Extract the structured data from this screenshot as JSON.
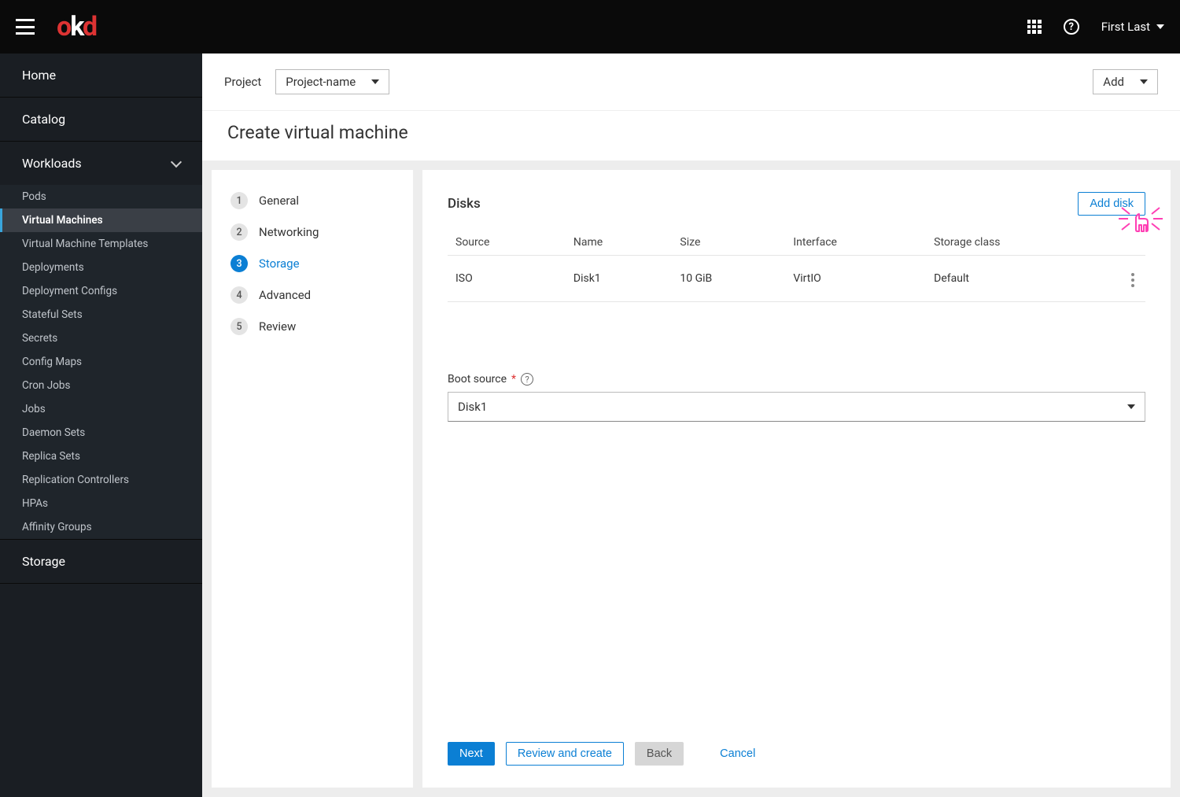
{
  "topbar": {
    "logo": "okd",
    "user_name": "First Last"
  },
  "sidebar": {
    "home": "Home",
    "catalog": "Catalog",
    "workloads": "Workloads",
    "storage": "Storage",
    "items": [
      {
        "label": "Pods"
      },
      {
        "label": "Virtual Machines"
      },
      {
        "label": "Virtual Machine Templates"
      },
      {
        "label": "Deployments"
      },
      {
        "label": "Deployment Configs"
      },
      {
        "label": "Stateful Sets"
      },
      {
        "label": "Secrets"
      },
      {
        "label": "Config Maps"
      },
      {
        "label": "Cron Jobs"
      },
      {
        "label": "Jobs"
      },
      {
        "label": "Daemon Sets"
      },
      {
        "label": "Replica Sets"
      },
      {
        "label": "Replication Controllers"
      },
      {
        "label": "HPAs"
      },
      {
        "label": "Affinity Groups"
      }
    ]
  },
  "context": {
    "project_label": "Project",
    "project_value": "Project-name",
    "add_label": "Add"
  },
  "page": {
    "title": "Create virtual machine"
  },
  "steps": [
    {
      "num": "1",
      "label": "General"
    },
    {
      "num": "2",
      "label": "Networking"
    },
    {
      "num": "3",
      "label": "Storage"
    },
    {
      "num": "4",
      "label": "Advanced"
    },
    {
      "num": "5",
      "label": "Review"
    }
  ],
  "disks": {
    "heading": "Disks",
    "add_button": "Add disk",
    "columns": {
      "source": "Source",
      "name": "Name",
      "size": "Size",
      "interface": "Interface",
      "storage_class": "Storage class"
    },
    "rows": [
      {
        "source": "ISO",
        "name": "Disk1",
        "size": "10 GiB",
        "interface": "VirtIO",
        "storage_class": "Default"
      }
    ]
  },
  "boot": {
    "label": "Boot source",
    "value": "Disk1"
  },
  "footer": {
    "next": "Next",
    "review": "Review and create",
    "back": "Back",
    "cancel": "Cancel"
  }
}
